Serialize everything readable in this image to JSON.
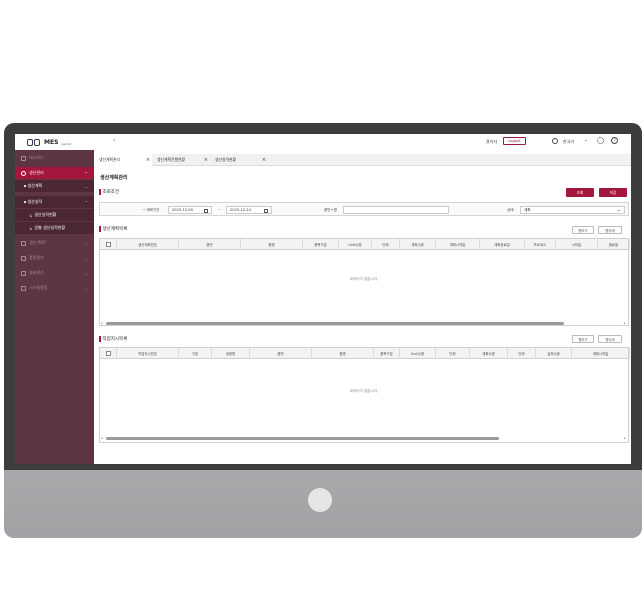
{
  "app": {
    "logo_text": "MES",
    "logo_version": "ver1.0"
  },
  "sidebar": {
    "items": [
      {
        "label": "대시보드"
      },
      {
        "label": "생산관리"
      },
      {
        "label": "생산계획"
      },
      {
        "label": "생산실적"
      },
      {
        "label": "생산실적현황"
      },
      {
        "label": "일별 생산실적현황"
      },
      {
        "label": "생산 POP"
      },
      {
        "label": "품질관리"
      },
      {
        "label": "설비관리"
      },
      {
        "label": "시스템설정"
      }
    ]
  },
  "header": {
    "back": "‹",
    "admin_label": "관리자",
    "logout_label": "Logout",
    "language": "한국어",
    "help": "?"
  },
  "tabs": [
    {
      "label": "생산계획관리"
    },
    {
      "label": "생산계획진행현황"
    },
    {
      "label": "생산실적현황"
    }
  ],
  "page": {
    "title": "생산계획관리",
    "search_section": "조회조건",
    "search_button": "조회",
    "save_button": "저장",
    "plan_period_label": "계획기간",
    "date_from": "2025-12-09",
    "date_sep": "~",
    "date_to": "2025-12-24",
    "part_no_label": "품번+명",
    "part_no_value": "",
    "status_label": "상태",
    "status_value": "계획"
  },
  "plan_grid": {
    "title": "생산계획목록",
    "add_row": "행추가",
    "delete_row": "행삭제",
    "columns": [
      "생산계획번호",
      "품번",
      "품명",
      "품목구분",
      "Unit수량",
      "단위",
      "계획수량",
      "계획시작일",
      "계획종료일",
      "프로세스",
      "시작일",
      "종료일"
    ],
    "empty_message": "데이터가 없습니다."
  },
  "work_grid": {
    "title": "작업지시목록",
    "add_row": "행추가",
    "delete_row": "행삭제",
    "columns": [
      "작업지시번호",
      "구분",
      "공정명",
      "품번",
      "품명",
      "품목구분",
      "Unit수량",
      "단위",
      "계획수량",
      "단위",
      "실적수량",
      "계획시작일"
    ],
    "empty_message": "데이터가 없습니다."
  },
  "colors": {
    "accent": "#a3163d",
    "sidebar": "#5e3643",
    "monitor_bezel": "#3d3d40"
  }
}
